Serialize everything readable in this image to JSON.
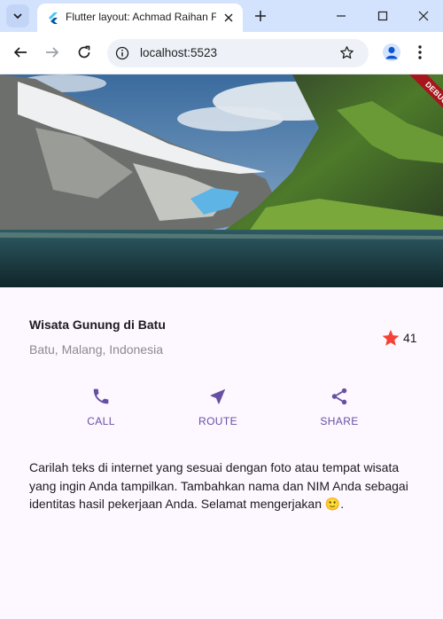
{
  "browser": {
    "tab_title": "Flutter layout: Achmad Raihan F",
    "url": "localhost:5523"
  },
  "app": {
    "debug_banner": "DEBUG",
    "title_section": {
      "name": "Wisata Gunung di Batu",
      "location": "Batu, Malang, Indonesia",
      "rating_count": "41"
    },
    "actions": [
      {
        "label": "CALL",
        "icon": "phone-icon"
      },
      {
        "label": "ROUTE",
        "icon": "navigation-arrow-icon"
      },
      {
        "label": "SHARE",
        "icon": "share-icon"
      }
    ],
    "description": "Carilah teks di internet yang sesuai dengan foto atau tempat wisata yang ingin Anda tampilkan. Tambahkan nama dan NIM Anda sebagai identitas hasil pekerjaan Anda. Selamat mengerjakan 🙂."
  },
  "colors": {
    "accent": "#6750a4",
    "star": "#f44336",
    "background": "#fdf7ff",
    "tab_strip": "#d3e3fd",
    "debug_ribbon": "#a6161c"
  }
}
